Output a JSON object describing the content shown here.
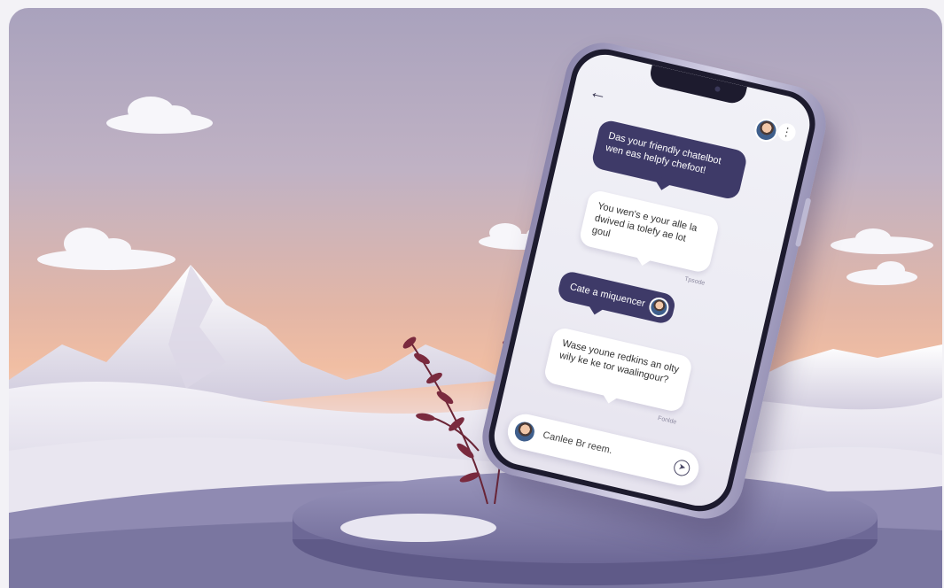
{
  "chat": {
    "back_icon": "arrow-left-icon",
    "more_icon": "more-vertical-icon",
    "messages": [
      {
        "text": "Das your friendly chatelbot wen eas helpfy chefoot!"
      },
      {
        "text": "You wen's e your alle la dwived ia tolefy ae lot goul"
      },
      {
        "text": "Cate a miquencer"
      },
      {
        "text": "Wase youne redkins an olty wily ke ke tor waalingour?"
      }
    ],
    "timestamps": [
      "Tpsode",
      "Fonlde"
    ],
    "composer_text": "Canlee Br reem.",
    "send_icon": "send-icon"
  },
  "colors": {
    "bubble_dark": "#3e3a68",
    "bubble_light": "#ffffff",
    "pedestal": "#7f7aa6",
    "leaves": "#7a2a3e"
  }
}
